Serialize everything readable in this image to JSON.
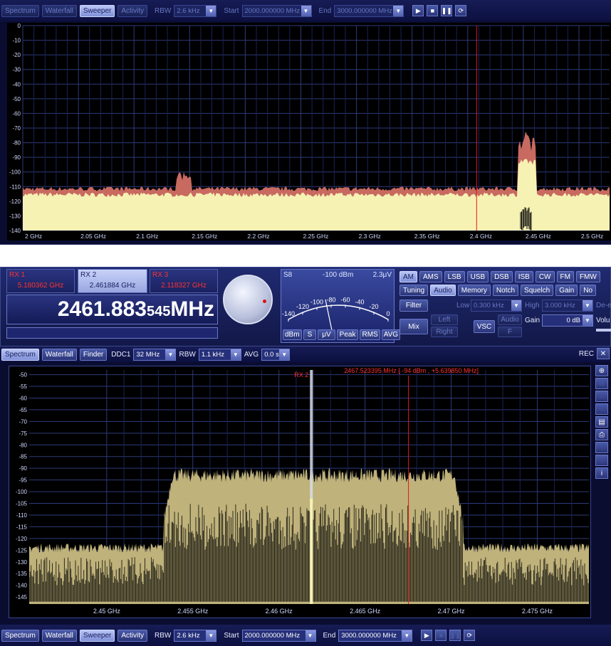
{
  "sweeper_window": {
    "tabs": [
      {
        "label": "Spectrum",
        "state": "dim"
      },
      {
        "label": "Waterfall",
        "state": "dim"
      },
      {
        "label": "Sweeper",
        "state": "on"
      },
      {
        "label": "Activity",
        "state": "dim"
      }
    ],
    "rbw_label": "RBW",
    "rbw_value": "2.6 kHz",
    "start_label": "Start",
    "start_value": "2000.000000 MHz",
    "end_label": "End",
    "end_value": "3000.000000 MHz",
    "x_ticks": [
      "2 GHz",
      "2.05 GHz",
      "2.1 GHz",
      "2.15 GHz",
      "2.2 GHz",
      "2.25 GHz",
      "2.3 GHz",
      "2.35 GHz",
      "2.4 GHz",
      "2.45 GHz",
      "2.5 GHz"
    ],
    "y_ticks": [
      "0",
      "-10",
      "-20",
      "-30",
      "-40",
      "-50",
      "-60",
      "-70",
      "-80",
      "-90",
      "-100",
      "-110",
      "-120",
      "-130",
      "-140"
    ]
  },
  "receiver": {
    "rx_boxes": [
      {
        "label": "RX 1",
        "freq": "5.180362 GHz",
        "state": "red"
      },
      {
        "label": "RX 2",
        "freq": "2.461884 GHz",
        "state": "sel"
      },
      {
        "label": "RX 3",
        "freq": "2.118327 GHz",
        "state": "red"
      }
    ],
    "freq_main": "2461.883",
    "freq_small": "545",
    "freq_unit": "MHz",
    "meter": {
      "s_label": "S8",
      "dbm_label": "-100 dBm",
      "uv_label": "2.3μV",
      "scale": [
        "-140",
        "-120",
        "-100",
        "-80",
        "-60",
        "-40",
        "-20",
        "0"
      ],
      "buttons": [
        {
          "label": "dBm",
          "state": "on"
        },
        {
          "label": "S",
          "state": ""
        },
        {
          "label": "μV",
          "state": ""
        },
        {
          "label": "Peak",
          "state": "dim"
        },
        {
          "label": "RMS",
          "state": "on"
        },
        {
          "label": "AVG",
          "state": ""
        }
      ]
    },
    "modes": [
      "AM",
      "AMS",
      "LSB",
      "USB",
      "DSB",
      "ISB",
      "CW",
      "FM",
      "FMW"
    ],
    "mode_on": "AM",
    "tabs": [
      "Tuning",
      "Audio",
      "Memory",
      "Notch",
      "Squelch",
      "Gain",
      "No"
    ],
    "tab_on": "Audio",
    "filter_label": "Filter",
    "mix_label": "Mix",
    "left_label": "Left",
    "right_label": "Right",
    "vsc_label": "VSC",
    "audio_label": "Audio",
    "audio_sub": "F",
    "low_label": "Low",
    "low_value": "0.300 kHz",
    "high_label": "High",
    "high_value": "3.000 kHz",
    "deemph_label": "De-e",
    "gain_label": "Gain",
    "gain_value": "0 dB",
    "volume_label": "Volu"
  },
  "spectrum_window": {
    "tabs": [
      {
        "label": "Spectrum",
        "state": "on"
      },
      {
        "label": "Waterfall",
        "state": ""
      },
      {
        "label": "Finder",
        "state": ""
      }
    ],
    "ddc_label": "DDC1",
    "ddc_value": "32 MHz",
    "rbw_label": "RBW",
    "rbw_value": "1.1 kHz",
    "avg_label": "AVG",
    "avg_value": "0.0 s",
    "rec_label": "REC",
    "marker_readout": "2467.523395 MHz [ -94 dBm , +5.639850 MHz]",
    "rx_marker_label": "RX 2",
    "x_ticks": [
      "2.45 GHz",
      "2.455 GHz",
      "2.46 GHz",
      "2.465 GHz",
      "2.47 GHz",
      "2.475 GHz"
    ],
    "y_ticks": [
      "-50",
      "-55",
      "-60",
      "-65",
      "-70",
      "-75",
      "-80",
      "-85",
      "-90",
      "-95",
      "-100",
      "-105",
      "-110",
      "-115",
      "-120",
      "-125",
      "-130",
      "-135",
      "-140",
      "-145"
    ]
  },
  "bottom_toolbar": {
    "tabs": [
      {
        "label": "Spectrum",
        "state": ""
      },
      {
        "label": "Waterfall",
        "state": ""
      },
      {
        "label": "Sweeper",
        "state": "on"
      },
      {
        "label": "Activity",
        "state": ""
      }
    ],
    "rbw_label": "RBW",
    "rbw_value": "2.6 kHz",
    "start_label": "Start",
    "start_value": "2000.000000 MHz",
    "end_label": "End",
    "end_value": "3000.000000 MHz"
  }
}
